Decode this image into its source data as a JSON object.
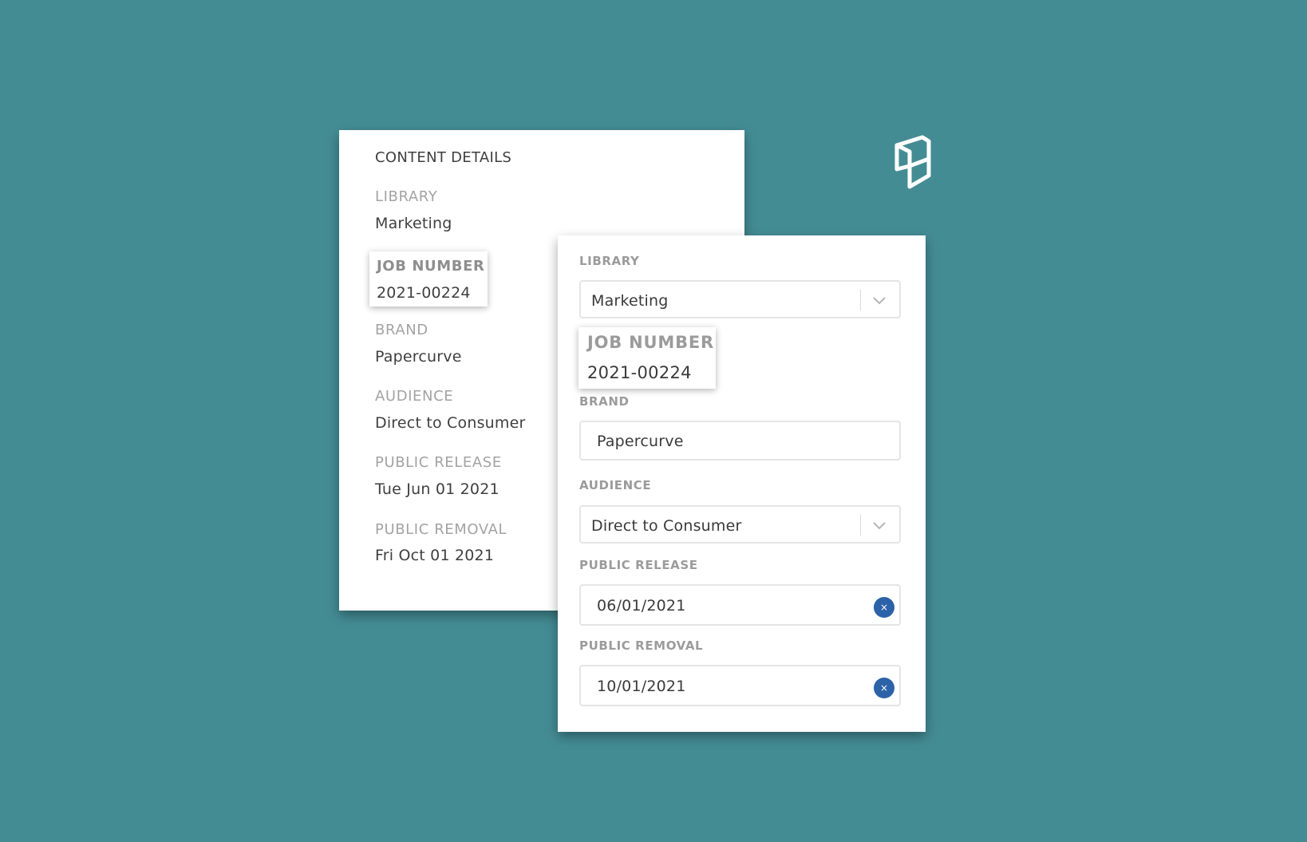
{
  "details": {
    "title": "CONTENT DETAILS",
    "library_label": "LIBRARY",
    "library_value": "Marketing",
    "job_number_label": "JOB NUMBER",
    "job_number_value": "2021-00224",
    "brand_label": "BRAND",
    "brand_value": "Papercurve",
    "audience_label": "AUDIENCE",
    "audience_value": "Direct to Consumer",
    "public_release_label": "PUBLIC RELEASE",
    "public_release_value": "Tue Jun 01 2021",
    "public_removal_label": "PUBLIC REMOVAL",
    "public_removal_value": "Fri Oct 01 2021"
  },
  "form": {
    "library_label": "LIBRARY",
    "library_value": "Marketing",
    "job_number_label": "JOB NUMBER",
    "job_number_value": "2021-00224",
    "brand_label": "BRAND",
    "brand_value": "Papercurve",
    "audience_label": "AUDIENCE",
    "audience_value": "Direct to Consumer",
    "public_release_label": "PUBLIC RELEASE",
    "public_release_value": "06/01/2021",
    "public_removal_label": "PUBLIC REMOVAL",
    "public_removal_value": "10/01/2021",
    "clear_glyph": "×"
  },
  "colors": {
    "background": "#448c94",
    "clear_button": "#2c62a8",
    "label": "#9b9b9b"
  },
  "icons": {
    "logo": "papercurve-logo-icon",
    "dropdown": "chevron-down-icon",
    "clear": "clear-icon"
  }
}
